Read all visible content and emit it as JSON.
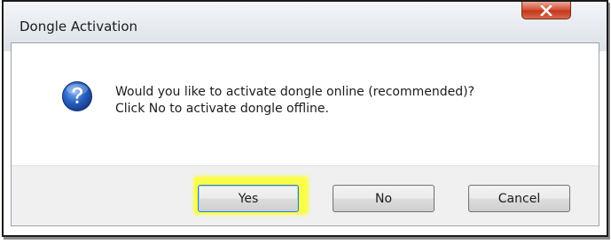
{
  "dialog": {
    "title": "Dongle Activation",
    "icon": "question-icon",
    "message_line1": "Would you like to activate dongle online (recommended)?",
    "message_line2": "Click No to activate dongle offline.",
    "buttons": {
      "yes_label": "Yes",
      "no_label": "No",
      "cancel_label": "Cancel"
    },
    "highlighted_button": "Yes"
  },
  "colors": {
    "highlight": "#fbff3a",
    "close_button": "#c5361c",
    "icon_blue": "#1f4fa8"
  }
}
